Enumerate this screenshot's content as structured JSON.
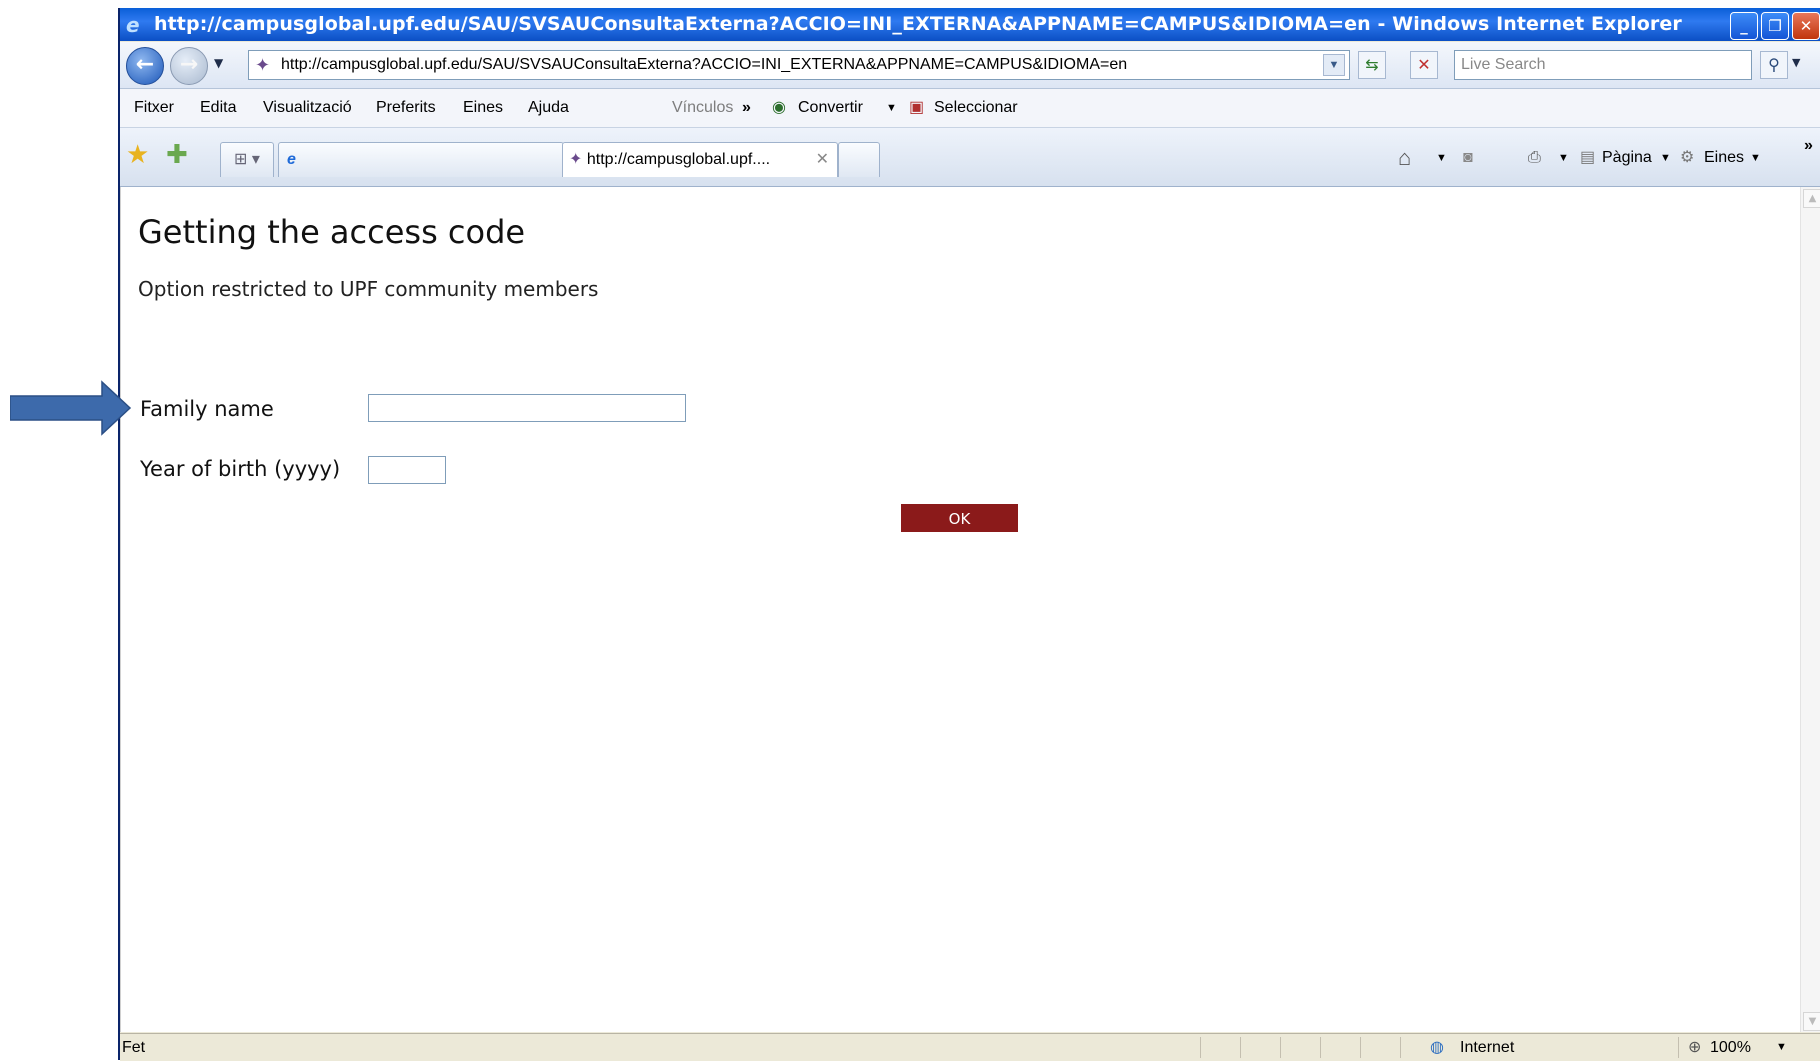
{
  "window": {
    "title": "http://campusglobal.upf.edu/SAU/SVSAUConsultaExterna?ACCIO=INI_EXTERNA&APPNAME=CAMPUS&IDIOMA=en - Windows Internet Explorer",
    "minimize": "_",
    "restore": "❐",
    "close": "✕"
  },
  "address_bar": {
    "url": "http://campusglobal.upf.edu/SAU/SVSAUConsultaExterna?ACCIO=INI_EXTERNA&APPNAME=CAMPUS&IDIOMA=en",
    "search_placeholder": "Live Search"
  },
  "menu": {
    "items": [
      "Fitxer",
      "Edita",
      "Visualització",
      "Preferits",
      "Eines",
      "Ajuda"
    ],
    "links_label": "Vínculos",
    "convert_label": "Convertir",
    "select_label": "Seleccionar"
  },
  "tabs": {
    "active_tab_label": "http://campusglobal.upf....",
    "page_menu": "Pàgina",
    "tools_menu": "Eines"
  },
  "page": {
    "title": "Getting the access code",
    "subtitle": "Option restricted to UPF community members",
    "family_name_label": "Family name",
    "family_name_value": "",
    "year_label": "Year of birth (yyyy)",
    "year_value": "",
    "ok_label": "OK"
  },
  "status": {
    "text": "Fet",
    "zone": "Internet",
    "zoom": "100%"
  },
  "colors": {
    "ok_button": "#8b1a1a",
    "annotation_arrow": "#3d6aab",
    "title_bar": "#0a5fd8"
  }
}
